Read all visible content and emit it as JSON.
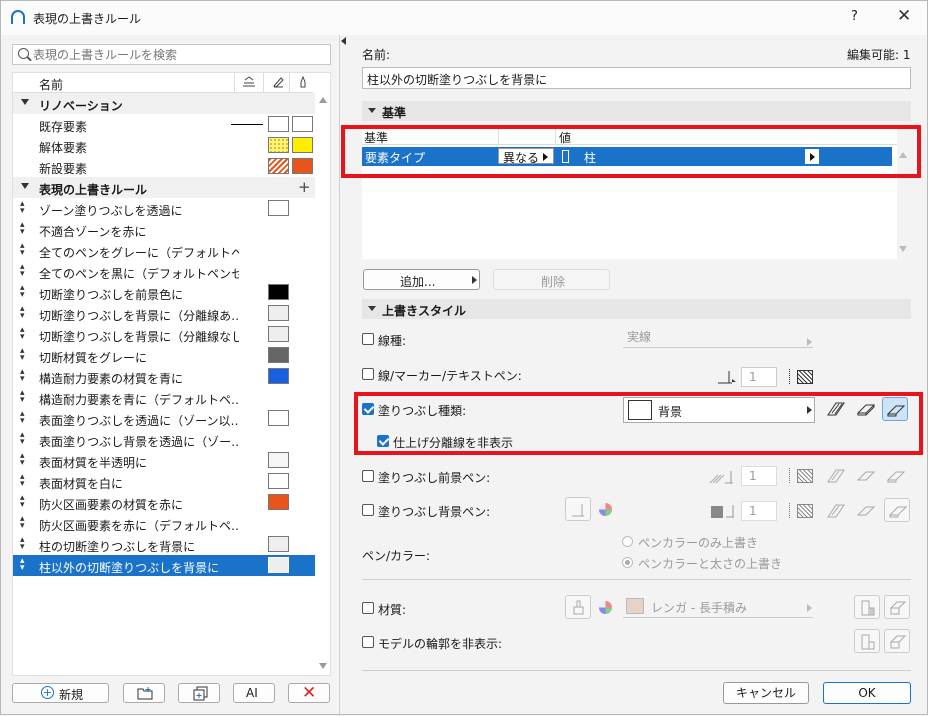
{
  "window": {
    "title": "表現の上書きルール",
    "help": "?",
    "close": "✕"
  },
  "search": {
    "placeholder": "表現の上書きルールを検索"
  },
  "list": {
    "header_name": "名前",
    "groups": [
      {
        "label": "リノベーション"
      },
      {
        "label": "表現の上書きルール",
        "add": "+"
      }
    ],
    "renovation": [
      {
        "label": "既存要素"
      },
      {
        "label": "解体要素"
      },
      {
        "label": "新設要素"
      }
    ],
    "rules": [
      {
        "label": "ゾーン塗りつぶしを透過に"
      },
      {
        "label": "不適合ゾーンを赤に"
      },
      {
        "label": "全てのペンをグレーに（デフォルトペン…"
      },
      {
        "label": "全てのペンを黒に（デフォルトペンセッ…"
      },
      {
        "label": "切断塗りつぶしを前景色に"
      },
      {
        "label": "切断塗りつぶしを背景に（分離線あ…"
      },
      {
        "label": "切断塗りつぶしを背景に（分離線なし"
      },
      {
        "label": "切断材質をグレーに"
      },
      {
        "label": "構造耐力要素の材質を青に"
      },
      {
        "label": "構造耐力要素を青に（デフォルトペ…"
      },
      {
        "label": "表面塗りつぶしを透過に（ゾーン以…"
      },
      {
        "label": "表面塗りつぶし背景を透過に（ゾー…"
      },
      {
        "label": "表面材質を半透明に"
      },
      {
        "label": "表面材質を白に"
      },
      {
        "label": "防火区画要素の材質を赤に"
      },
      {
        "label": "防火区画要素を赤に（デフォルトペ…"
      },
      {
        "label": "柱の切断塗りつぶしを背景に"
      },
      {
        "label": "柱以外の切断塗りつぶしを背景に"
      }
    ]
  },
  "bottom_left": {
    "new_label": "新規"
  },
  "name_field": {
    "label": "名前:",
    "value": "柱以外の切断塗りつぶしを背景に",
    "editable": "編集可能: 1"
  },
  "criteria": {
    "section": "基準",
    "col1": "基準",
    "col2": "値",
    "row": {
      "criterion": "要素タイプ",
      "operator": "異なる",
      "value": "柱"
    },
    "add_label": "追加...",
    "delete_label": "削除"
  },
  "style": {
    "section": "上書きスタイル",
    "line_type": {
      "label": "線種:",
      "value": "実線"
    },
    "line_marker_pen": {
      "label": "線/マーカー/テキストペン:",
      "pen": "1"
    },
    "fill_type": {
      "label": "塗りつぶし種類:",
      "value": "背景"
    },
    "hide_sep": {
      "label": "仕上げ分離線を非表示"
    },
    "fill_fg_pen": {
      "label": "塗りつぶし前景ペン:",
      "pen": "1"
    },
    "fill_bg_pen": {
      "label": "塗りつぶし背景ペン:",
      "pen": "1"
    },
    "pen_color": {
      "label": "ペン/カラー:",
      "opt1": "ペンカラーのみ上書き",
      "opt2": "ペンカラーと太さの上書き"
    },
    "material": {
      "label": "材質:",
      "value": "レンガ - 長手積み"
    },
    "hide_contour": {
      "label": "モデルの輪郭を非表示:"
    }
  },
  "footer": {
    "cancel": "キャンセル",
    "ok": "OK"
  },
  "colors": {
    "accent": "#1a73c8",
    "highlight": "#e8141b",
    "orange": "#e8541a",
    "yellow": "#ffee00"
  }
}
